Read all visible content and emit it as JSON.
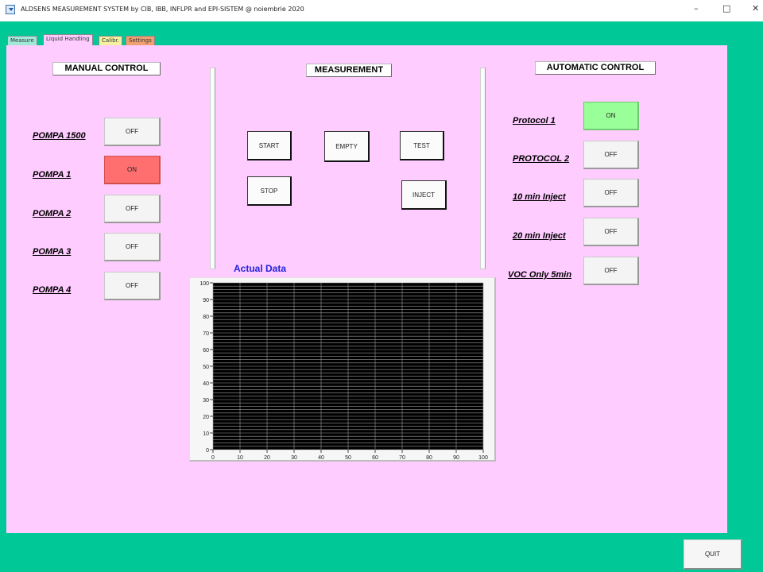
{
  "window": {
    "title": "ALDSENS MEASUREMENT SYSTEM by CIB, IBB, INFLPR and EPI-SISTEM @ noiembrie 2020",
    "minimize": "–",
    "maximize": "□",
    "close": "✕"
  },
  "tabs": [
    {
      "label": "Measure",
      "color": "#a0e8d8"
    },
    {
      "label": "Liquid Handling",
      "color": "#ffccff",
      "active": true
    },
    {
      "label": "Calibr.",
      "color": "#f5f0a0"
    },
    {
      "label": "Settings",
      "color": "#f0a070"
    }
  ],
  "manual": {
    "heading": "MANUAL CONTROL",
    "pumps": [
      {
        "label": "POMPA 1500",
        "state": "OFF"
      },
      {
        "label": "POMPA 1",
        "state": "ON"
      },
      {
        "label": "POMPA 2",
        "state": "OFF"
      },
      {
        "label": "POMPA 3",
        "state": "OFF"
      },
      {
        "label": "POMPA 4",
        "state": "OFF"
      }
    ]
  },
  "measurement": {
    "heading": "MEASUREMENT",
    "start": "START",
    "empty": "EMPTY",
    "test": "TEST",
    "stop": "STOP",
    "inject": "INJECT"
  },
  "automatic": {
    "heading": "AUTOMATIC CONTROL",
    "protocols": [
      {
        "label": "Protocol 1",
        "state": "ON"
      },
      {
        "label": "PROTOCOL 2",
        "state": "OFF"
      },
      {
        "label": "10 min Inject",
        "state": "OFF"
      },
      {
        "label": "20 min Inject",
        "state": "OFF"
      },
      {
        "label": "VOC Only 5min",
        "state": "OFF"
      }
    ]
  },
  "chart_title": "Actual Data",
  "chart_data": {
    "type": "line",
    "title": "Actual Data",
    "x": [],
    "series": [],
    "xlim": [
      0,
      100
    ],
    "ylim": [
      0,
      100
    ],
    "xticks": [
      "0",
      "10",
      "20",
      "30",
      "40",
      "50",
      "60",
      "70",
      "80",
      "90",
      "100"
    ],
    "yticks": [
      "0",
      "10",
      "20",
      "30",
      "40",
      "50",
      "60",
      "70",
      "80",
      "90",
      "100"
    ],
    "grid": true,
    "background": "#000000"
  },
  "quit": "QUIT"
}
